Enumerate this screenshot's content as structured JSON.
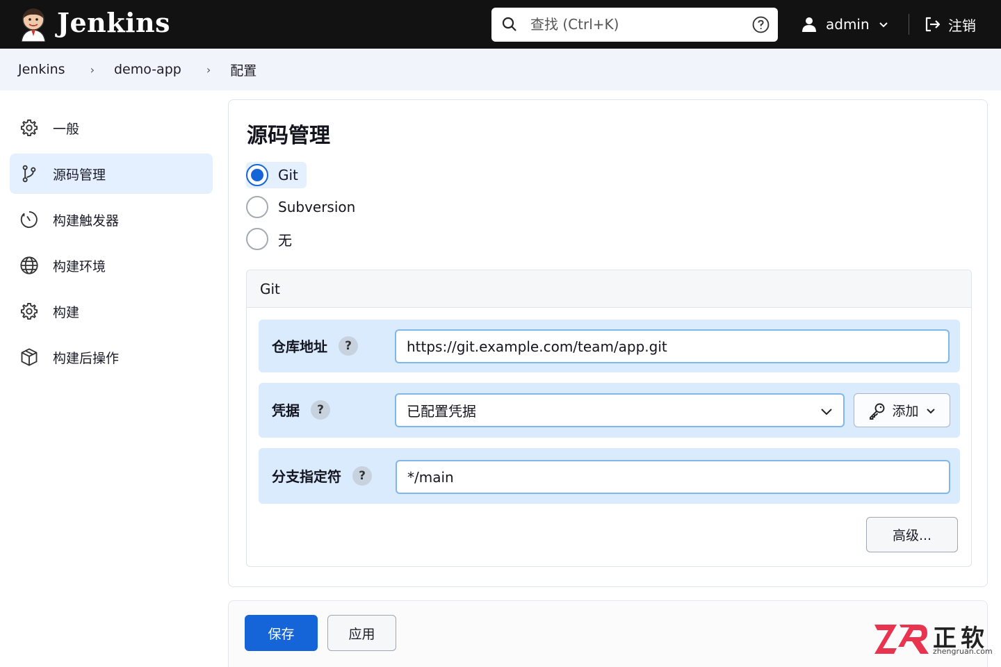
{
  "header": {
    "brand": "Jenkins",
    "search_placeholder": "查找 (Ctrl+K)",
    "user_name": "admin",
    "logout_label": "注销"
  },
  "breadcrumb": [
    "Jenkins",
    "demo-app",
    "配置"
  ],
  "sidebar": {
    "items": [
      {
        "label": "一般",
        "icon": "gear-icon"
      },
      {
        "label": "源码管理",
        "icon": "branch-icon",
        "active": true
      },
      {
        "label": "构建触发器",
        "icon": "clock-icon"
      },
      {
        "label": "构建环境",
        "icon": "globe-icon"
      },
      {
        "label": "构建",
        "icon": "gear-icon"
      },
      {
        "label": "构建后操作",
        "icon": "package-icon"
      }
    ]
  },
  "scm": {
    "title": "源码管理",
    "options": [
      {
        "label": "Git",
        "selected": true
      },
      {
        "label": "Subversion",
        "selected": false
      },
      {
        "label": "无",
        "selected": false
      }
    ],
    "git": {
      "header": "Git",
      "repo_label": "仓库地址",
      "repo_value": "https://git.example.com/team/app.git",
      "cred_label": "凭据",
      "cred_value": "已配置凭据",
      "add_label": "添加",
      "branch_label": "分支指定符",
      "branch_value": "*/main",
      "help_mark": "?",
      "advanced_label": "高级..."
    }
  },
  "actions": {
    "save": "保存",
    "apply": "应用"
  },
  "watermark": {
    "cn": "正软",
    "url": "zhengruan.com"
  },
  "colors": {
    "accent": "#1565d8",
    "header_bg": "#121212",
    "field_bg": "#d9ebfc",
    "sidebar_active": "#e4efff",
    "watermark_red": "#e8344f"
  }
}
